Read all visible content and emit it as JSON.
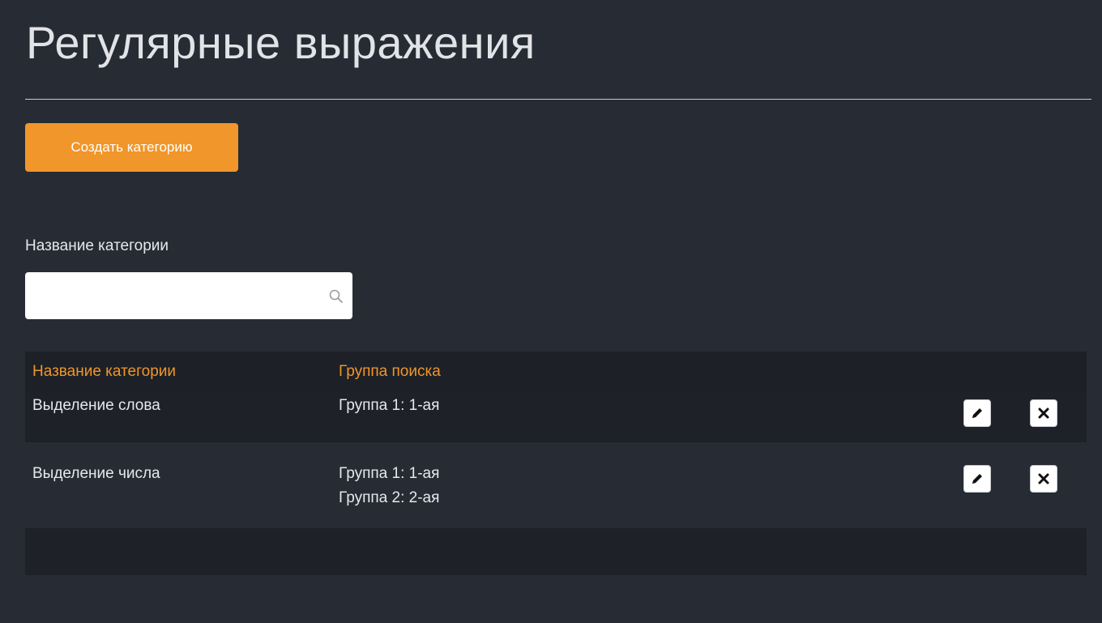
{
  "header": {
    "title": "Регулярные выражения"
  },
  "toolbar": {
    "create_label": "Создать категорию"
  },
  "filter": {
    "label": "Название категории",
    "value": "",
    "placeholder": ""
  },
  "table": {
    "columns": [
      "Название категории",
      "Группа поиска"
    ],
    "rows": [
      {
        "name": "Выделение слова",
        "groups": [
          "Группа 1: 1-ая"
        ]
      },
      {
        "name": "Выделение числа",
        "groups": [
          "Группа 1: 1-ая",
          "Группа 2: 2-ая"
        ]
      }
    ]
  },
  "icons": {
    "search": "search-icon",
    "edit": "pencil-icon",
    "delete": "close-icon"
  },
  "colors": {
    "accent": "#f0962a",
    "background": "#272b34",
    "header_row": "#1d2026"
  }
}
